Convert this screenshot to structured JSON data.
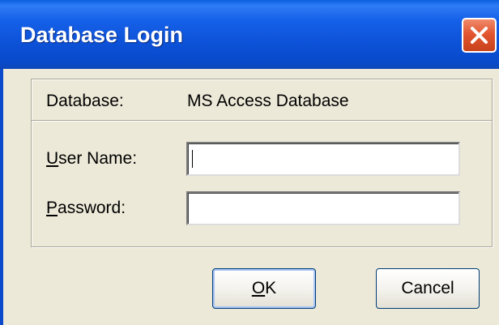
{
  "window": {
    "title": "Database Login"
  },
  "info": {
    "database_label": "Database:",
    "database_value": "MS Access Database"
  },
  "form": {
    "username": {
      "label_accel": "U",
      "label_rest": "ser Name:",
      "value": ""
    },
    "password": {
      "label_accel": "P",
      "label_rest": "assword:",
      "value": ""
    }
  },
  "buttons": {
    "ok_accel": "O",
    "ok_rest": "K",
    "cancel": "Cancel"
  },
  "colors": {
    "titlebar": "#0a4acb",
    "close_button": "#e25630",
    "dialog_bg": "#ece9d8"
  },
  "icons": {
    "close": "close-icon"
  }
}
